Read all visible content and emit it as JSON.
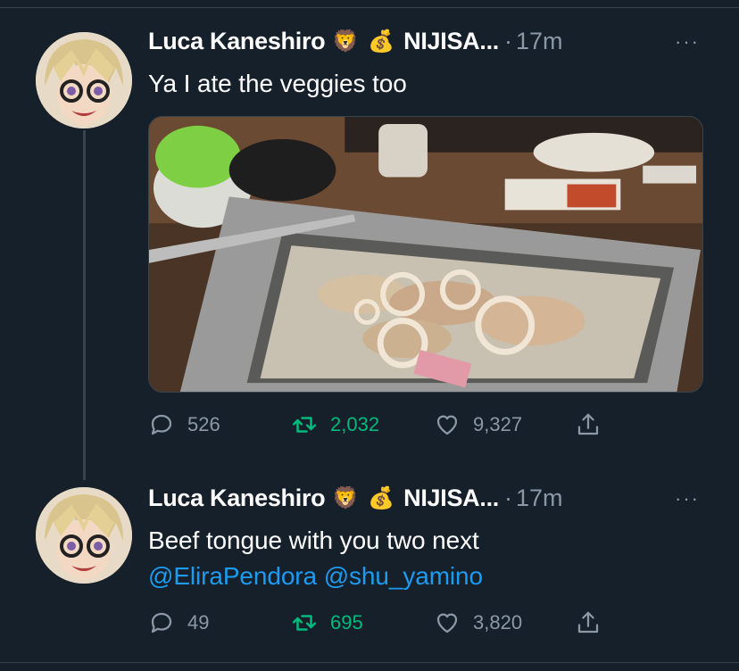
{
  "tweets": [
    {
      "author_name": "Luca Kaneshiro",
      "emoji_1": "🦁",
      "emoji_2": "💰",
      "affiliation": "NIJISA...",
      "time": "17m",
      "more": "···",
      "text": "Ya I ate the veggies too",
      "media": "korean-bbq-grill-photo",
      "replies": "526",
      "retweets": "2,032",
      "likes": "9,327"
    },
    {
      "author_name": "Luca Kaneshiro",
      "emoji_1": "🦁",
      "emoji_2": "💰",
      "affiliation": "NIJISA...",
      "time": "17m",
      "more": "···",
      "text_line1": "Beef tongue with you two next",
      "mention_1": "@EliraPendora",
      "mention_2": "@shu_yamino",
      "replies": "49",
      "retweets": "695",
      "likes": "3,820"
    }
  ],
  "icons": {
    "reply": "reply-icon",
    "retweet": "retweet-icon",
    "like": "heart-icon",
    "share": "share-icon"
  },
  "colors": {
    "background": "#15202b",
    "secondary_text": "#8b98a5",
    "link": "#1d9bf0",
    "retweet_active": "#00ba7c",
    "divider": "#38444d"
  }
}
